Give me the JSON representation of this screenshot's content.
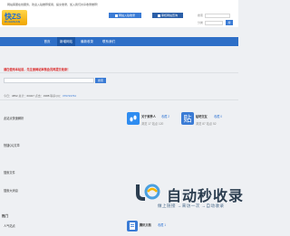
{
  "notice": "网站客服在线服务，欢迎入驻推荐使用、提交收录，加入我们共享收录推荐！",
  "logo": {
    "main": "快ZS",
    "sub": "KUAIZHAN",
    "brand_color": "#1f6fd1"
  },
  "header_buttons": [
    {
      "label": "网站入驻收录",
      "icon": "user-icon"
    },
    {
      "label": "审核网站查询",
      "icon": "doc-icon"
    }
  ],
  "header_search": {
    "label1": "搜索",
    "label2": "分类",
    "go_label": "搜"
  },
  "nav": {
    "items": [
      "首页",
      "新增网站",
      "最新收录",
      "联系我们"
    ],
    "active_index": 1
  },
  "alert": "请在使用本站前，先注册网站审核会员再提交收录！",
  "search": {
    "button": "搜索"
  },
  "stats": {
    "prefix1": "今日：",
    "v1": "3852",
    "prefix2": "  总计：",
    "v2": "60327",
    "prefix3": "  点击：",
    "v3": "3388",
    "prefix4": "  联系QQ：",
    "v4": "379723764"
  },
  "left_items": [
    {
      "title": "此站点快速解析",
      "sub": ""
    },
    {
      "title": "快捷QQ文章",
      "sub": ""
    },
    {
      "title": "搜索文件",
      "sub": ""
    },
    {
      "title": "搜索大消息",
      "sub": ""
    },
    {
      "title": "人气站点",
      "sub": ""
    }
  ],
  "cards": [
    {
      "name": "关于家养人",
      "badge": "收藏 2",
      "meta": "浏览 17   站点 120",
      "icon": "footprint-icon",
      "color": "#2e8cf0"
    },
    {
      "name": "贴吧交友",
      "badge": "收藏 0",
      "meta": "浏览 87   站点 52",
      "icon": "tie-icon",
      "color": "#3a7bd5"
    },
    {
      "name": "腾讯文档",
      "badge": "收藏 1",
      "meta": "",
      "icon": "tencent-doc-icon",
      "color": "#3a7bd5"
    }
  ],
  "section_title": "热门",
  "watermark": {
    "brand": "自动秒收录",
    "tagline": "做上链接 →来访一次 →自动收录"
  }
}
